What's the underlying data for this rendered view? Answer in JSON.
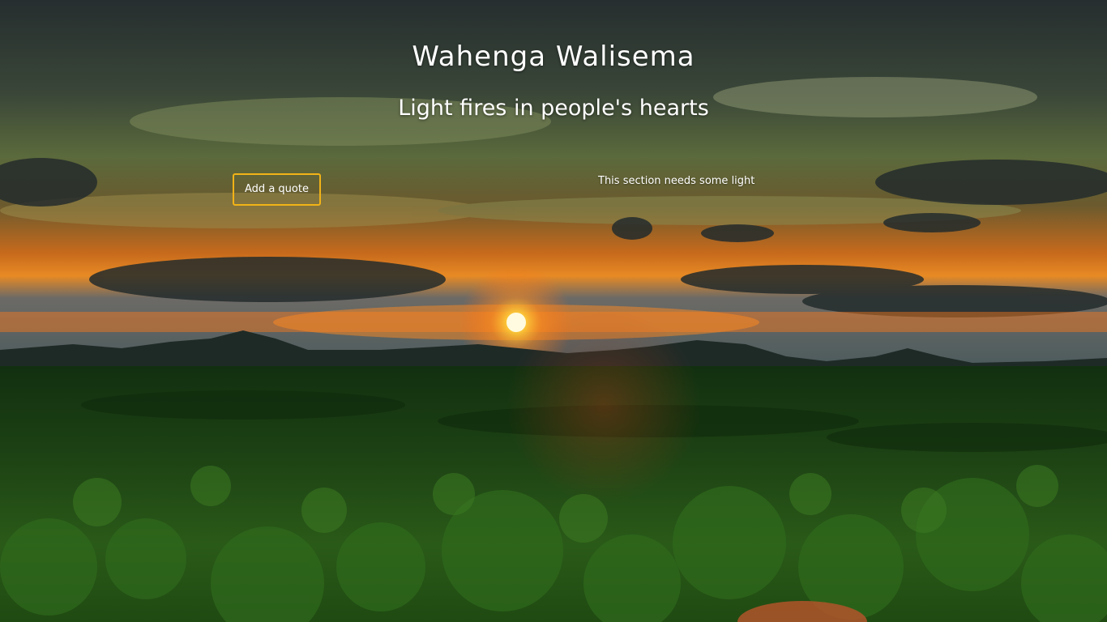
{
  "header": {
    "title": "Wahenga Walisema",
    "tagline": "Light fires in people's hearts"
  },
  "actions": {
    "add_quote_label": "Add a quote"
  },
  "content": {
    "section_note": "This section needs some light"
  },
  "colors": {
    "button_border": "#f2b316",
    "text": "#ffffff",
    "sky_top": "#2b3534",
    "sun": "#ffd23a",
    "forest": "#1d4a12"
  }
}
